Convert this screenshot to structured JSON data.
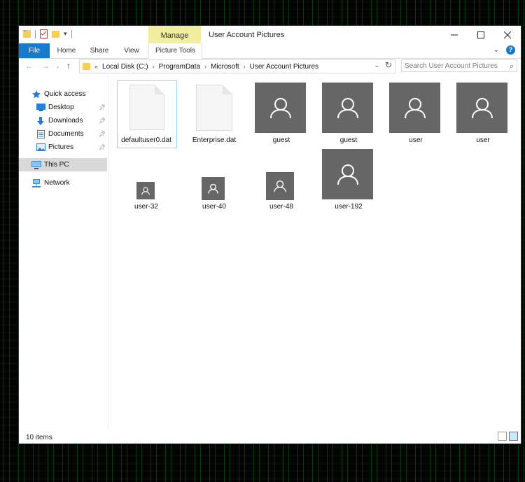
{
  "window": {
    "title": "User Account Pictures",
    "contextual_tab_header": "Manage",
    "controls": [
      "minimize",
      "maximize",
      "close"
    ]
  },
  "ribbon": {
    "tabs": [
      "File",
      "Home",
      "Share",
      "View",
      "Picture Tools"
    ]
  },
  "address": {
    "overflow": "«",
    "path": [
      "Local Disk (C:)",
      "ProgramData",
      "Microsoft",
      "User Account Pictures"
    ],
    "search_placeholder": "Search User Account Pictures"
  },
  "navigation": {
    "items": [
      {
        "label": "Quick access",
        "icon": "star-icon"
      },
      {
        "label": "Desktop",
        "icon": "desktop-icon",
        "pinned": true
      },
      {
        "label": "Downloads",
        "icon": "download-icon",
        "pinned": true
      },
      {
        "label": "Documents",
        "icon": "documents-icon",
        "pinned": true
      },
      {
        "label": "Pictures",
        "icon": "pictures-icon",
        "pinned": true
      },
      {
        "label": "This PC",
        "icon": "computer-icon",
        "selected": true
      },
      {
        "label": "Network",
        "icon": "network-icon"
      }
    ]
  },
  "files": [
    {
      "name": "defaultuser0.dat",
      "type": "file",
      "selected": true
    },
    {
      "name": "Enterprise.dat",
      "type": "file"
    },
    {
      "name": "guest",
      "type": "image"
    },
    {
      "name": "guest",
      "type": "image"
    },
    {
      "name": "user",
      "type": "image"
    },
    {
      "name": "user",
      "type": "image"
    },
    {
      "name": "user-32",
      "type": "image"
    },
    {
      "name": "user-40",
      "type": "image"
    },
    {
      "name": "user-48",
      "type": "image"
    },
    {
      "name": "user-192",
      "type": "image"
    }
  ],
  "status": {
    "item_count": "10 items"
  },
  "colors": {
    "accent": "#1979ca",
    "manage_tab": "#f2ee9f",
    "avatar_bg": "#666666",
    "selection": "#99d1ff"
  }
}
